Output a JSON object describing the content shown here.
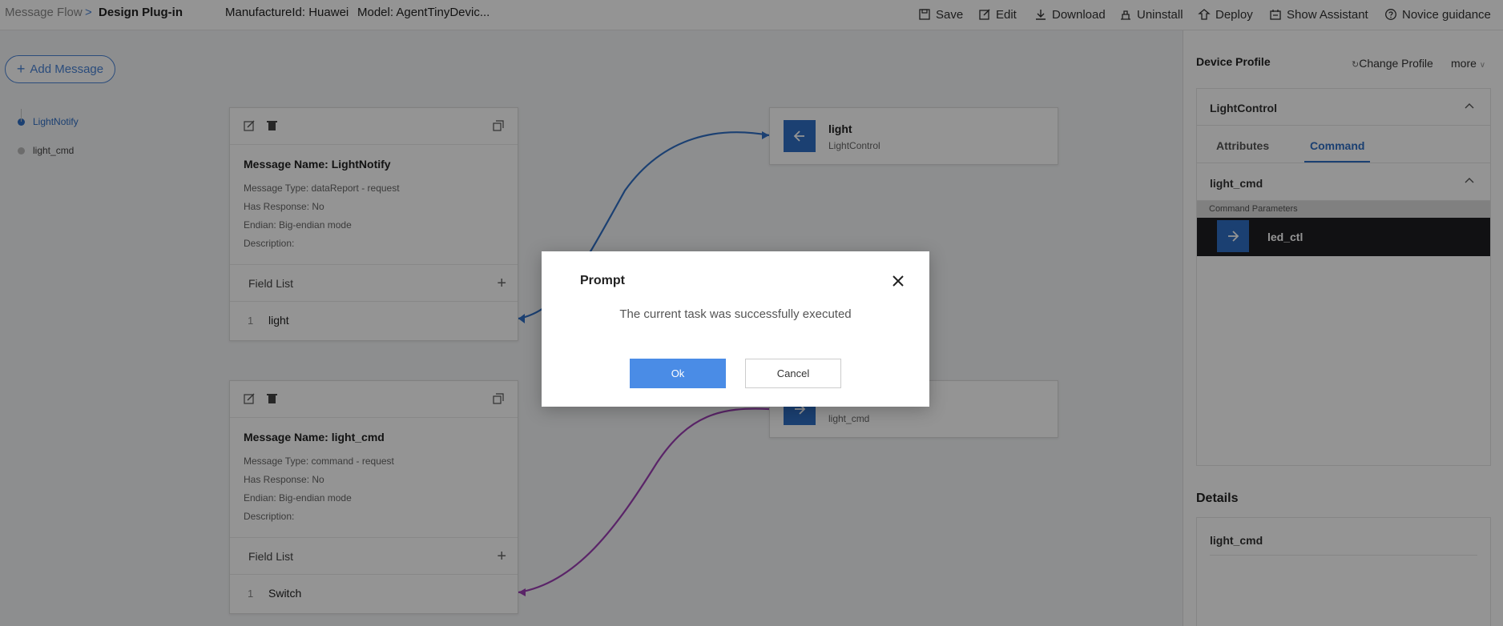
{
  "breadcrumb": {
    "root": "Message Flow",
    "separator": ">",
    "current": "Design Plug-in"
  },
  "meta": {
    "manufacturer": "ManufactureId: Huawei",
    "model": "Model: AgentTinyDevic..."
  },
  "toolbar": {
    "save": "Save",
    "edit": "Edit",
    "download": "Download",
    "uninstall": "Uninstall",
    "deploy": "Deploy",
    "assistant": "Show Assistant",
    "guidance": "Novice guidance"
  },
  "canvas": {
    "add_message": "Add Message",
    "tree": [
      "LightNotify",
      "light_cmd"
    ],
    "messages": [
      {
        "title": "Message Name: LightNotify",
        "type": "Message Type: dataReport - request",
        "response": "Has Response: No",
        "endian": "Endian: Big-endian mode",
        "description": "Description:",
        "field_list": "Field List",
        "fields": [
          {
            "index": "1",
            "name": "light"
          }
        ]
      },
      {
        "title": "Message Name: light_cmd",
        "type": "Message Type: command - request",
        "response": "Has Response: No",
        "endian": "Endian: Big-endian mode",
        "description": "Description:",
        "field_list": "Field List",
        "fields": [
          {
            "index": "1",
            "name": "Switch"
          }
        ]
      }
    ],
    "targets": [
      {
        "name": "light",
        "sub": "LightControl"
      },
      {
        "name": "",
        "sub": "light_cmd"
      }
    ],
    "link_colors": {
      "notify": "#2f6ec4",
      "command": "#9b3fb3"
    }
  },
  "right_panel": {
    "title": "Device Profile",
    "change_profile": "Change Profile",
    "more": "more",
    "service": "LightControl",
    "tabs": [
      "Attributes",
      "Command"
    ],
    "active_tab": "Command",
    "command": "light_cmd",
    "param_label": "Command Parameters",
    "param": "led_ctl",
    "details_title": "Details",
    "details_value": "light_cmd"
  },
  "dialog": {
    "title": "Prompt",
    "message": "The current task was successfully executed",
    "ok": "Ok",
    "cancel": "Cancel"
  }
}
